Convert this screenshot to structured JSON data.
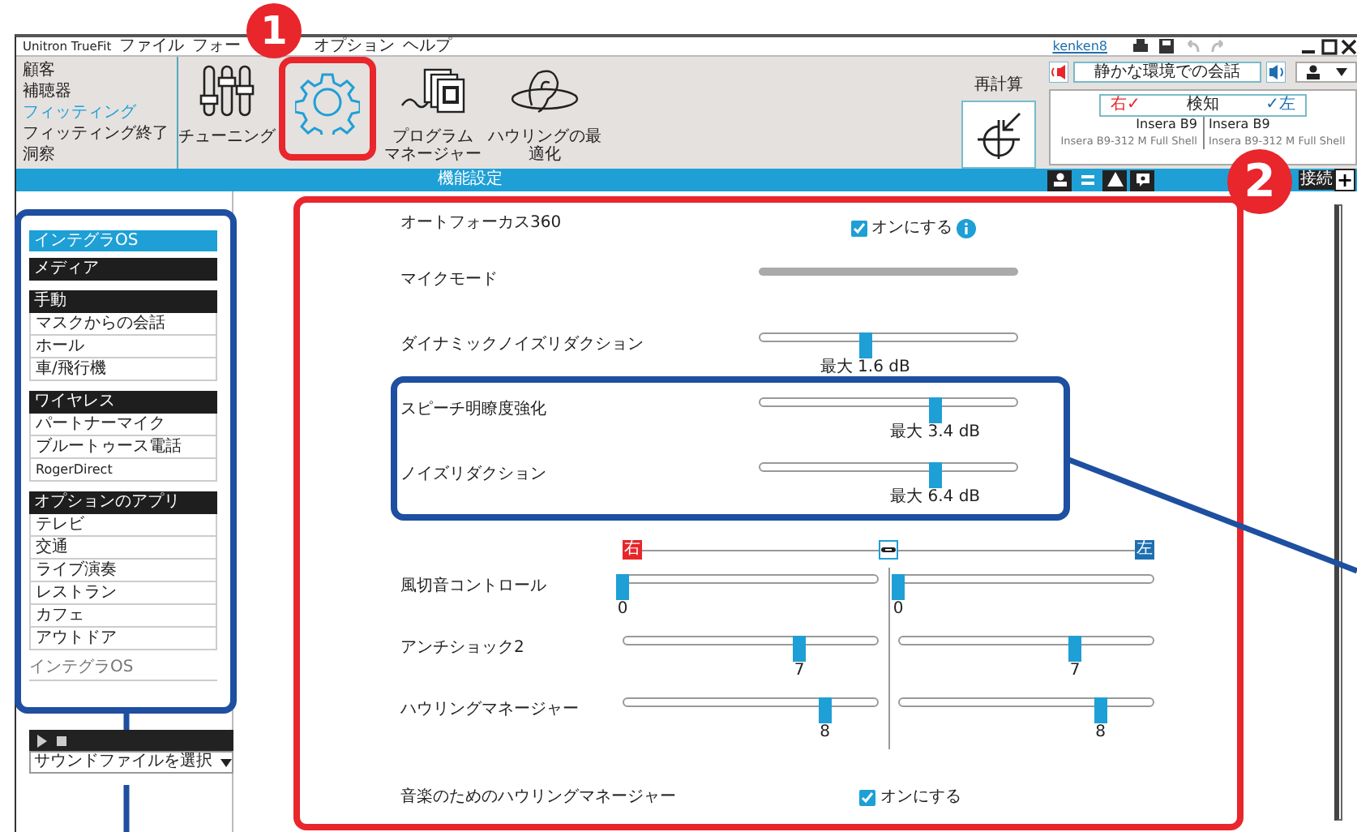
{
  "callouts": [
    {
      "number": "1"
    },
    {
      "number": "2"
    }
  ],
  "menu": [
    "Unitron TrueFit",
    "ファイル",
    "フォー",
    "オプション",
    "ヘルプ"
  ],
  "user": "kenken8",
  "nav": [
    {
      "label": "顧客",
      "selected": false
    },
    {
      "label": "補聴器",
      "selected": false
    },
    {
      "label": "フィッティング",
      "selected": true
    },
    {
      "label": "フィッティング終了",
      "selected": false
    },
    {
      "label": "洞察",
      "selected": false
    }
  ],
  "tools": [
    {
      "kind": "tuning",
      "label": [
        "チューニング"
      ],
      "selected": false
    },
    {
      "kind": "settings",
      "selected": true
    },
    {
      "kind": "program",
      "label": [
        "プログラム",
        "マネージャー"
      ],
      "selected": false
    },
    {
      "kind": "howling",
      "label": [
        "ハウリングの最",
        "適化"
      ],
      "selected": false
    }
  ],
  "section_title": "機能設定",
  "recalc": "再計算",
  "program": "静かな環境での会話",
  "detect": {
    "right": "右✓",
    "status": "検知",
    "left": "✓左"
  },
  "devices": [
    {
      "model": "Insera B9",
      "detail": "Insera B9-312 M Full Shell"
    },
    {
      "model": "Insera B9",
      "detail": "Insera B9-312 M Full Shell"
    }
  ],
  "connect": "接続",
  "add": "+",
  "sidebar": {
    "title": "インテグラOS",
    "groups": [
      {
        "title": "メディア"
      },
      {
        "title": "手動",
        "items": [
          "マスクからの会話",
          "ホール",
          "車/飛行機"
        ]
      },
      {
        "title": "ワイヤレス",
        "items": [
          "パートナーマイク",
          "ブルートゥース電話",
          "RogerDirect"
        ]
      },
      {
        "title": "オプションのアプリ",
        "items": [
          "テレビ",
          "交通",
          "ライブ演奏",
          "レストラン",
          "カフェ",
          "アウトドア"
        ]
      }
    ],
    "footer": "インテグラOS"
  },
  "sound_file": "サウンドファイルを選択",
  "features": [
    {
      "kind": "checkbox",
      "label": "オートフォーカス360",
      "checked": true,
      "option": "オンにする",
      "info": true
    },
    {
      "kind": "bar",
      "label": "マイクモード"
    },
    {
      "kind": "slider",
      "label": "ダイナミックノイズリダクション",
      "level": 0.41,
      "reading": "最大 1.6 dB"
    },
    {
      "kind": "slider",
      "label": "スピーチ明瞭度強化",
      "level": 0.68,
      "reading": "最大 3.4 dB"
    },
    {
      "kind": "slider",
      "label": "ノイズリダクション",
      "level": 0.68,
      "reading": "最大 6.4 dB"
    }
  ],
  "binaural": {
    "right": "右",
    "left": "左",
    "rows": [
      {
        "label": "風切音コントロール",
        "right": {
          "level": 0,
          "reading": "0"
        },
        "left": {
          "level": 0,
          "reading": "0"
        }
      },
      {
        "label": "アンチショック2",
        "right": {
          "level": 0.69,
          "reading": "7"
        },
        "left": {
          "level": 0.69,
          "reading": "7"
        }
      },
      {
        "label": "ハウリングマネージャー",
        "right": {
          "level": 0.79,
          "reading": "8"
        },
        "left": {
          "level": 0.79,
          "reading": "8"
        }
      }
    ]
  },
  "music": {
    "label": "音楽のためのハウリングマネージャー",
    "checked": true,
    "option": "オンにする"
  }
}
